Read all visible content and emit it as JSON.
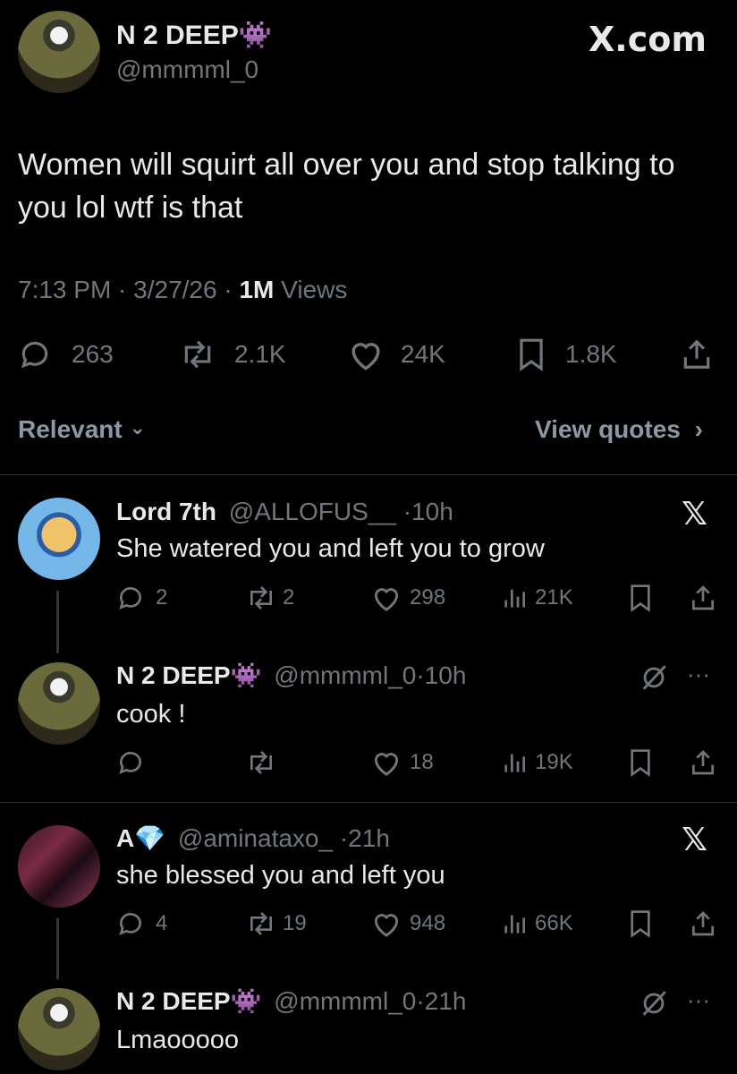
{
  "post": {
    "author_name": "N 2 DEEP",
    "author_emoji": "👾",
    "author_handle": "@mmmml_0",
    "site": "X.com",
    "text_line1": "Women will squirt all over you and stop talking to",
    "text_line2": "you lol wtf is that",
    "time": "7:13 PM · 3/27/26 · ",
    "views_count": "1M",
    "views_label": " Views",
    "replies": "263",
    "reposts": "2.1K",
    "likes": "24K",
    "bookmarks": "1.8K"
  },
  "sort": {
    "label": "Relevant",
    "chevron": "⌄",
    "view_quotes": "View quotes",
    "view_quotes_chevron": "›"
  },
  "replies": [
    {
      "name": "Lord 7th",
      "handle": "@ALLOFUS__",
      "time": "·10h",
      "text": "She watered you and left you to grow",
      "replies": "2",
      "reposts": "2",
      "likes": "298",
      "views": "21K",
      "corner": "𝕏"
    },
    {
      "name": "N 2 DEEP",
      "emoji": "👾",
      "handle": "@mmmml_0",
      "time": "·10h",
      "text": "cook !",
      "replies": "",
      "reposts": "",
      "likes": "18",
      "views": "19K",
      "more": "···"
    },
    {
      "name": "A",
      "emoji": "💎",
      "handle": "@aminataxo_",
      "time": "·21h",
      "text": "she blessed you and left you",
      "replies": "4",
      "reposts": "19",
      "likes": "948",
      "views": "66K",
      "corner": "𝕏"
    },
    {
      "name": "N 2 DEEP",
      "emoji": "👾",
      "handle": "@mmmml_0",
      "time": "·21h",
      "text": "Lmaooooo",
      "more": "···"
    }
  ]
}
